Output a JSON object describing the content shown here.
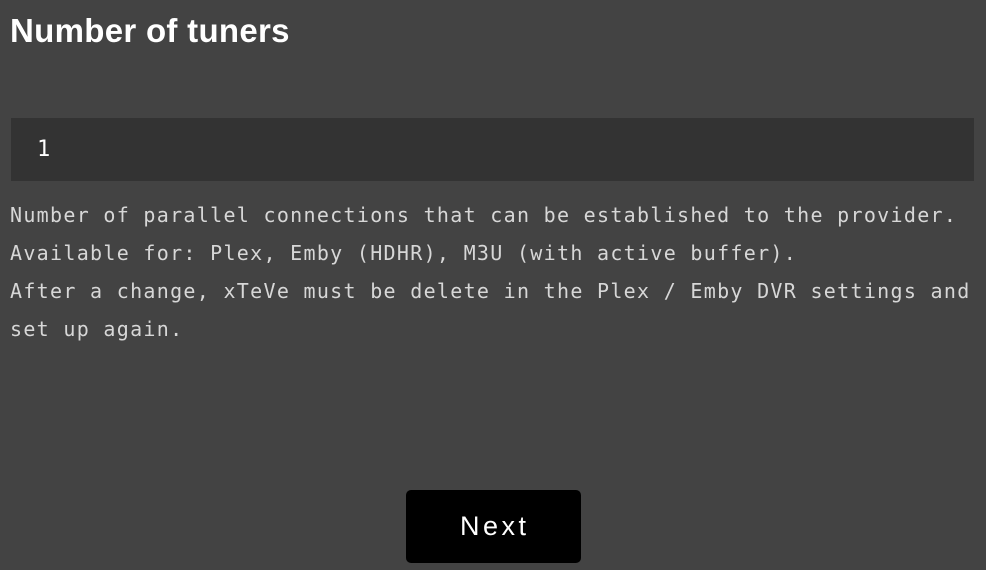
{
  "page": {
    "title": "Number of tuners",
    "background_color": "#434343",
    "text_color": "#d7d7d7"
  },
  "tuner_field": {
    "name": "number-of-tuners",
    "value": "1",
    "placeholder": "",
    "background_color": "#333333"
  },
  "description": {
    "text": "Number of parallel connections that can be established to the provider.\nAvailable for: Plex, Emby (HDHR), M3U (with active buffer).\nAfter a change, xTeVe must be delete in the Plex / Emby DVR settings and set up again.",
    "lines": [
      "Number of parallel connections that can be established to the provider.",
      "Available for: Plex, Emby (HDHR), M3U (with active buffer).",
      "After a change, xTeVe must be delete in the Plex / Emby DVR settings and set up again."
    ]
  },
  "actions": {
    "next_label": "Next",
    "next_background_color": "#000000"
  }
}
